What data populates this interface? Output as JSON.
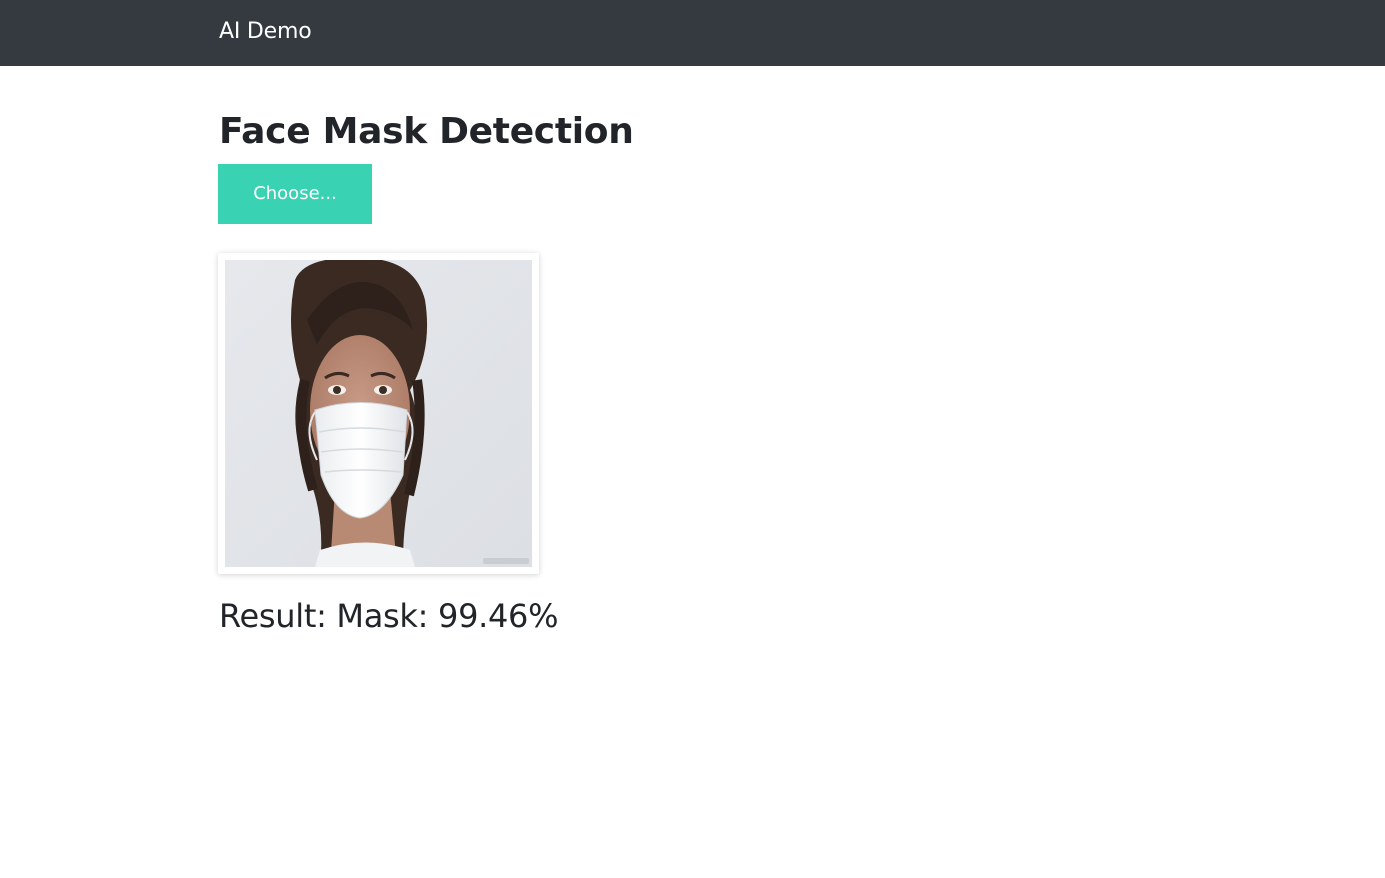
{
  "navbar": {
    "brand": "AI Demo",
    "background": "#343a40"
  },
  "main": {
    "title": "Face Mask Detection",
    "choose_button": {
      "label": "Choose...",
      "color": "#39d3b4"
    },
    "preview": {
      "subject": "person-wearing-face-mask-photo"
    },
    "result": "Result: Mask: 99.46%"
  }
}
